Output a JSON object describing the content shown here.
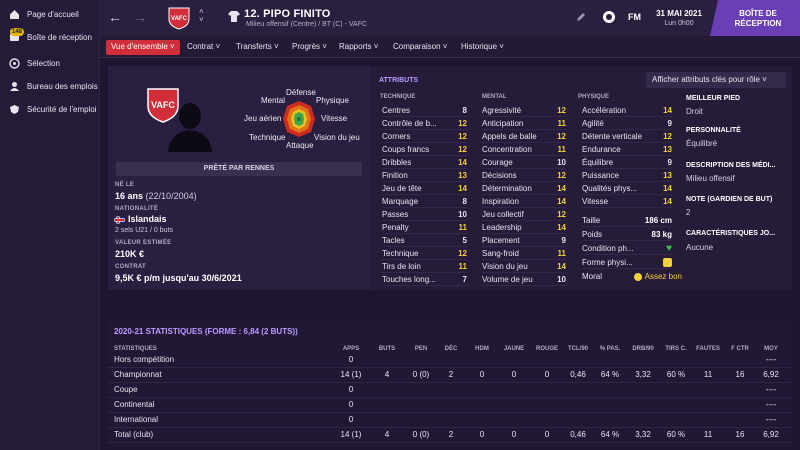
{
  "sidebar": {
    "items": [
      {
        "label": "Page d'accueil",
        "icon": "home-icon"
      },
      {
        "label": "Boîte de réception",
        "icon": "inbox-icon",
        "badge": "148"
      },
      {
        "label": "Sélection",
        "icon": "selection-icon"
      },
      {
        "label": "Bureau des emplois",
        "icon": "jobs-icon"
      },
      {
        "label": "Sécurité de l'emploi",
        "icon": "job-security-icon"
      }
    ]
  },
  "header": {
    "player_name": "12. PIPO FINITO",
    "player_sub": "Milieu offensif (Centre) / BT (C) - VAFC",
    "club_abbr": "VAFC",
    "fm_logo": "FM",
    "date": "31 MAI 2021",
    "time": "Lun 0h00",
    "inbox_button": "BOÎTE DE RÉCEPTION"
  },
  "tabs": [
    {
      "label": "Vue d'ensemble",
      "active": true
    },
    {
      "label": "Contrat"
    },
    {
      "label": "Transferts"
    },
    {
      "label": "Progrès"
    },
    {
      "label": "Rapports"
    },
    {
      "label": "Comparaison"
    },
    {
      "label": "Historique"
    }
  ],
  "profile": {
    "radar_labels": {
      "defense": "Défense",
      "mental": "Mental",
      "physique": "Physique",
      "jeu_aerien": "Jeu aérien",
      "vitesse": "Vitesse",
      "technique": "Technique",
      "vision": "Vision du jeu",
      "attaque": "Attaque"
    },
    "loan_status": "PRÊTÉ PAR RENNES",
    "age_label": "NÉ LE",
    "age_value": "16 ans",
    "birth_date": "(22/10/2004)",
    "nationality_label": "NATIONALITÉ",
    "nationality_value": "Islandais",
    "caps": "2 sels U21 / 0 buts",
    "value_label": "VALEUR ESTIMÉE",
    "value_value": "210K €",
    "contract_label": "CONTRAT",
    "contract_value": "9,5K € p/m jusqu'au 30/6/2021"
  },
  "attributes": {
    "title": "ATTRIBUTS",
    "role_button": "Afficher attributs clés pour rôle",
    "technique_head": "TECHNIQUE",
    "mental_head": "MENTAL",
    "physique_head": "PHYSIQUE",
    "technique": [
      {
        "label": "Centres",
        "value": "8"
      },
      {
        "label": "Contrôle de b...",
        "value": "12"
      },
      {
        "label": "Corners",
        "value": "12"
      },
      {
        "label": "Coups francs",
        "value": "12"
      },
      {
        "label": "Dribbles",
        "value": "14"
      },
      {
        "label": "Finition",
        "value": "13"
      },
      {
        "label": "Jeu de tête",
        "value": "14"
      },
      {
        "label": "Marquage",
        "value": "8"
      },
      {
        "label": "Passes",
        "value": "10"
      },
      {
        "label": "Penalty",
        "value": "11"
      },
      {
        "label": "Tacles",
        "value": "5"
      },
      {
        "label": "Technique",
        "value": "12"
      },
      {
        "label": "Tirs de loin",
        "value": "11"
      },
      {
        "label": "Touches long...",
        "value": "7"
      }
    ],
    "mental": [
      {
        "label": "Agressivité",
        "value": "12"
      },
      {
        "label": "Anticipation",
        "value": "11"
      },
      {
        "label": "Appels de balle",
        "value": "12"
      },
      {
        "label": "Concentration",
        "value": "11"
      },
      {
        "label": "Courage",
        "value": "10"
      },
      {
        "label": "Décisions",
        "value": "12"
      },
      {
        "label": "Détermination",
        "value": "14"
      },
      {
        "label": "Inspiration",
        "value": "14"
      },
      {
        "label": "Jeu collectif",
        "value": "12"
      },
      {
        "label": "Leadership",
        "value": "14"
      },
      {
        "label": "Placement",
        "value": "9"
      },
      {
        "label": "Sang-froid",
        "value": "11"
      },
      {
        "label": "Vision du jeu",
        "value": "14"
      },
      {
        "label": "Volume de jeu",
        "value": "10"
      }
    ],
    "physique": [
      {
        "label": "Accélération",
        "value": "14"
      },
      {
        "label": "Agilité",
        "value": "9"
      },
      {
        "label": "Détente verticale",
        "value": "12"
      },
      {
        "label": "Endurance",
        "value": "13"
      },
      {
        "label": "Équilibre",
        "value": "9"
      },
      {
        "label": "Puissance",
        "value": "13"
      },
      {
        "label": "Qualités phys...",
        "value": "14"
      },
      {
        "label": "Vitesse",
        "value": "14"
      }
    ],
    "body": [
      {
        "label": "Taille",
        "value": "186 cm"
      },
      {
        "label": "Poids",
        "value": "83 kg"
      },
      {
        "label": "Condition ph...",
        "value": ""
      },
      {
        "label": "Forme physi...",
        "value": ""
      },
      {
        "label": "Moral",
        "value": "Assez bon"
      }
    ]
  },
  "key_info": {
    "foot_label": "MEILLEUR PIED",
    "foot_value": "Droit",
    "personality_label": "PERSONNALITÉ",
    "personality_value": "Équilibré",
    "media_label": "DESCRIPTION DES MÉDI...",
    "media_value": "Milieu offensif",
    "gk_label": "NOTE (GARDIEN DE BUT)",
    "gk_value": "2",
    "traits_label": "CARACTÉRISTIQUES JO...",
    "traits_value": "Aucune"
  },
  "stats": {
    "title": "2020-21 STATISTIQUES (FORME : 6,84 (2 BUTS))",
    "headers": [
      "STATISTIQUES",
      "APPS",
      "BUTS",
      "PEN",
      "DÉC",
      "HDM",
      "JAUNE",
      "ROUGE",
      "TCL/90",
      "% PAS.",
      "DRB/90",
      "TIRS C.",
      "FAUTES",
      "F CTR",
      "MOY"
    ],
    "rows": [
      [
        "Hors compétition",
        "0",
        "",
        "",
        "",
        "",
        "",
        "",
        "",
        "",
        "",
        "",
        "",
        "",
        "----"
      ],
      [
        "Championnat",
        "14 (1)",
        "4",
        "0 (0)",
        "2",
        "0",
        "0",
        "0",
        "0,46",
        "64 %",
        "3,32",
        "60 %",
        "11",
        "16",
        "6,92"
      ],
      [
        "Coupe",
        "0",
        "",
        "",
        "",
        "",
        "",
        "",
        "",
        "",
        "",
        "",
        "",
        "",
        "----"
      ],
      [
        "Continental",
        "0",
        "",
        "",
        "",
        "",
        "",
        "",
        "",
        "",
        "",
        "",
        "",
        "",
        "----"
      ],
      [
        "International",
        "0",
        "",
        "",
        "",
        "",
        "",
        "",
        "",
        "",
        "",
        "",
        "",
        "",
        "----"
      ],
      [
        "Total (club)",
        "14 (1)",
        "4",
        "0 (0)",
        "2",
        "0",
        "0",
        "0",
        "0,46",
        "64 %",
        "3,32",
        "60 %",
        "11",
        "16",
        "6,92"
      ]
    ]
  },
  "colors": {
    "accent": "#d12d3a",
    "inbox": "#6a3fb5",
    "highlight_yellow": "#f2d23a",
    "purple_title": "#b99cff"
  }
}
